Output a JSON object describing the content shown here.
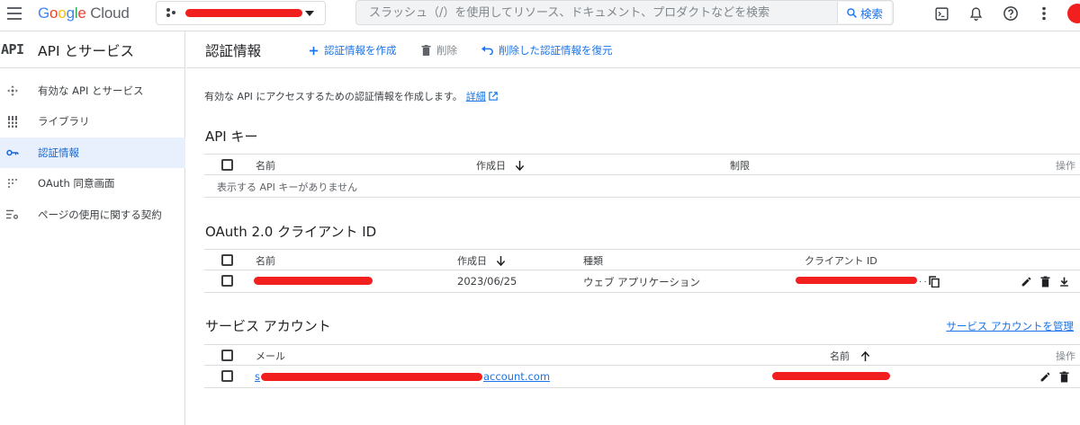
{
  "header": {
    "brand": {
      "google": "Google",
      "cloud": "Cloud"
    },
    "search": {
      "placeholder": "スラッシュ（/）を使用してリソース、ドキュメント、プロダクトなどを検索",
      "button_label": "検索"
    },
    "icons": [
      "menu-icon",
      "project-icon",
      "search-icon",
      "terminal-icon",
      "bell-icon",
      "help-icon",
      "more-vert-icon",
      "avatar"
    ]
  },
  "sidebar": {
    "logo": "API",
    "title": "API とサービス",
    "items": [
      {
        "label": "有効な API とサービス",
        "icon": "api-move-icon"
      },
      {
        "label": "ライブラリ",
        "icon": "library-icon"
      },
      {
        "label": "認証情報",
        "icon": "key-icon",
        "active": true
      },
      {
        "label": "OAuth 同意画面",
        "icon": "oauth-icon"
      },
      {
        "label": "ページの使用に関する契約",
        "icon": "settings-list-icon"
      }
    ]
  },
  "main": {
    "title": "認証情報",
    "actions": {
      "create": "認証情報を作成",
      "delete": "削除",
      "restore": "削除した認証情報を復元"
    },
    "description": "有効な API にアクセスするための認証情報を作成します。",
    "details_link": "詳細",
    "api_keys": {
      "title": "API キー",
      "columns": [
        "名前",
        "作成日",
        "制限",
        "操作"
      ],
      "empty_text": "表示する API キーがありません"
    },
    "oauth": {
      "title": "OAuth 2.0 クライアント ID",
      "columns": [
        "名前",
        "作成日",
        "種類",
        "クライアント ID"
      ],
      "rows": [
        {
          "created": "2023/06/25",
          "type": "ウェブ アプリケーション",
          "client_id_suffix": ". ."
        }
      ]
    },
    "service_accounts": {
      "title": "サービス アカウント",
      "manage_link": "サービス アカウントを管理",
      "columns": [
        "メール",
        "名前",
        "操作"
      ],
      "rows": [
        {
          "email_prefix": "s",
          "email_suffix": "account.com"
        }
      ]
    }
  },
  "colors": {
    "accent": "#1a73e8",
    "active_bg": "#e8f0fe",
    "redaction": "#f21f1f",
    "border": "#dadce0"
  }
}
